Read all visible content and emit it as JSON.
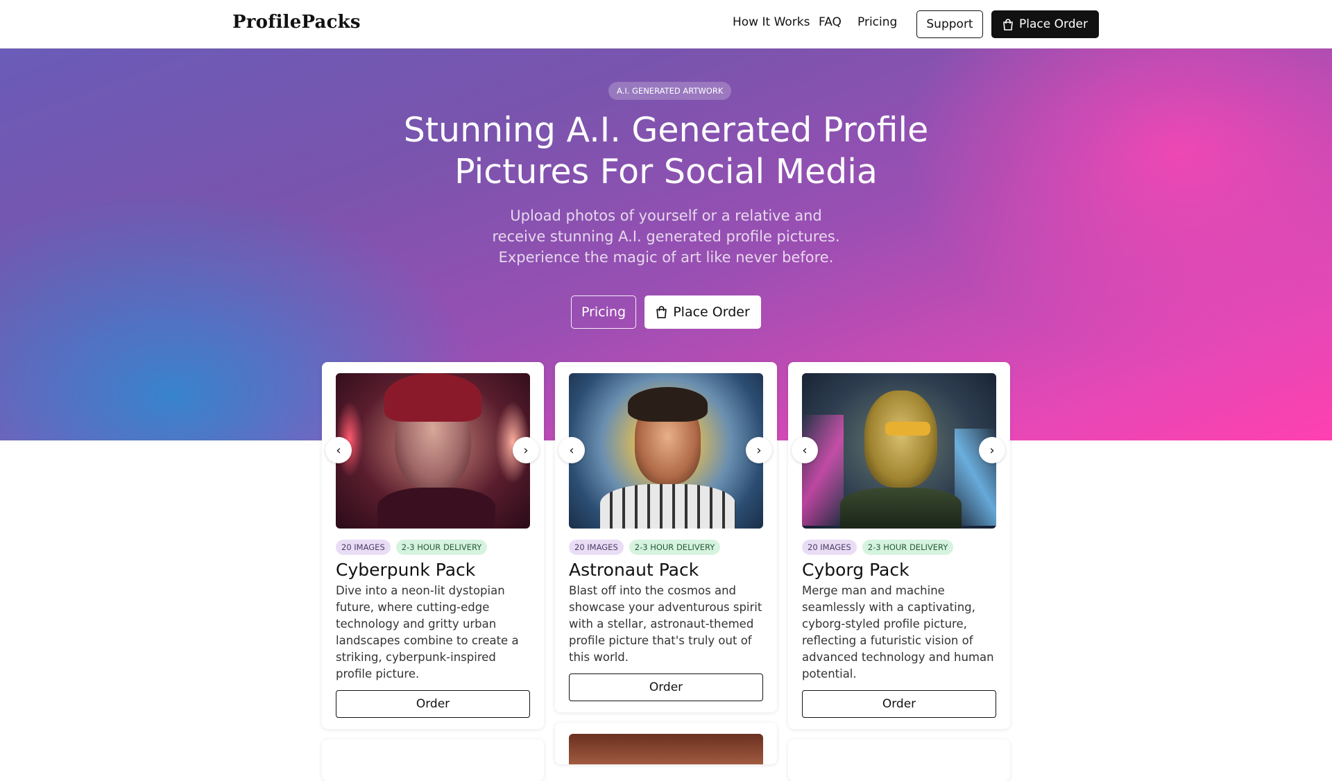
{
  "header": {
    "logo": "ProfilePacks",
    "nav": [
      "How It Works",
      "FAQ",
      "Pricing"
    ],
    "support_label": "Support",
    "order_label": "Place Order"
  },
  "hero": {
    "pill": "A.I. GENERATED ARTWORK",
    "title": "Stunning A.I. Generated Profile Pictures For Social Media",
    "subtitle": "Upload photos of yourself or a relative and receive stunning A.I. generated profile pictures. Experience the magic of art like never before.",
    "pricing_label": "Pricing",
    "order_label": "Place Order"
  },
  "cards": [
    {
      "badge_images": "20 IMAGES",
      "badge_delivery": "2-3 HOUR DELIVERY",
      "title": "Cyberpunk Pack",
      "description": "Dive into a neon-lit dystopian future, where cutting-edge technology and gritty urban landscapes combine to create a striking, cyberpunk-inspired profile picture.",
      "button": "Order"
    },
    {
      "badge_images": "20 IMAGES",
      "badge_delivery": "2-3 HOUR DELIVERY",
      "title": "Astronaut Pack",
      "description": "Blast off into the cosmos and showcase your adventurous spirit with a stellar, astronaut-themed profile picture that's truly out of this world.",
      "button": "Order"
    },
    {
      "badge_images": "20 IMAGES",
      "badge_delivery": "2-3 HOUR DELIVERY",
      "title": "Cyborg Pack",
      "description": "Merge man and machine seamlessly with a captivating, cyborg-styled profile picture, reflecting a futuristic vision of advanced technology and human potential.",
      "button": "Order"
    }
  ],
  "icons": {
    "bag": "shopping-bag-icon",
    "prev": "chevron-left-icon",
    "next": "chevron-right-icon"
  }
}
